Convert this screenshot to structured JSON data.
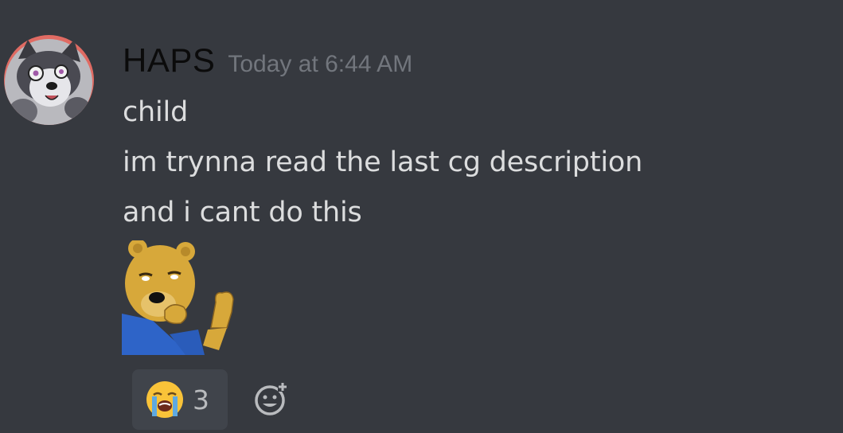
{
  "message": {
    "author": "HAPS",
    "timestamp": "Today at 6:44 AM",
    "lines": [
      "child",
      "im trynna read the last cg description",
      "and i cant do this"
    ],
    "avatar_icon": "wolf-avatar-icon",
    "sticker_icon": "shrugging-bear-sticker",
    "reaction": {
      "emoji_icon": "loudly-crying-face-icon",
      "count": "3"
    },
    "add_reaction_icon": "add-reaction-icon"
  },
  "colors": {
    "background": "#36393f",
    "text": "#dcddde",
    "timestamp": "#72767d",
    "reaction_bg": "#40444b"
  }
}
